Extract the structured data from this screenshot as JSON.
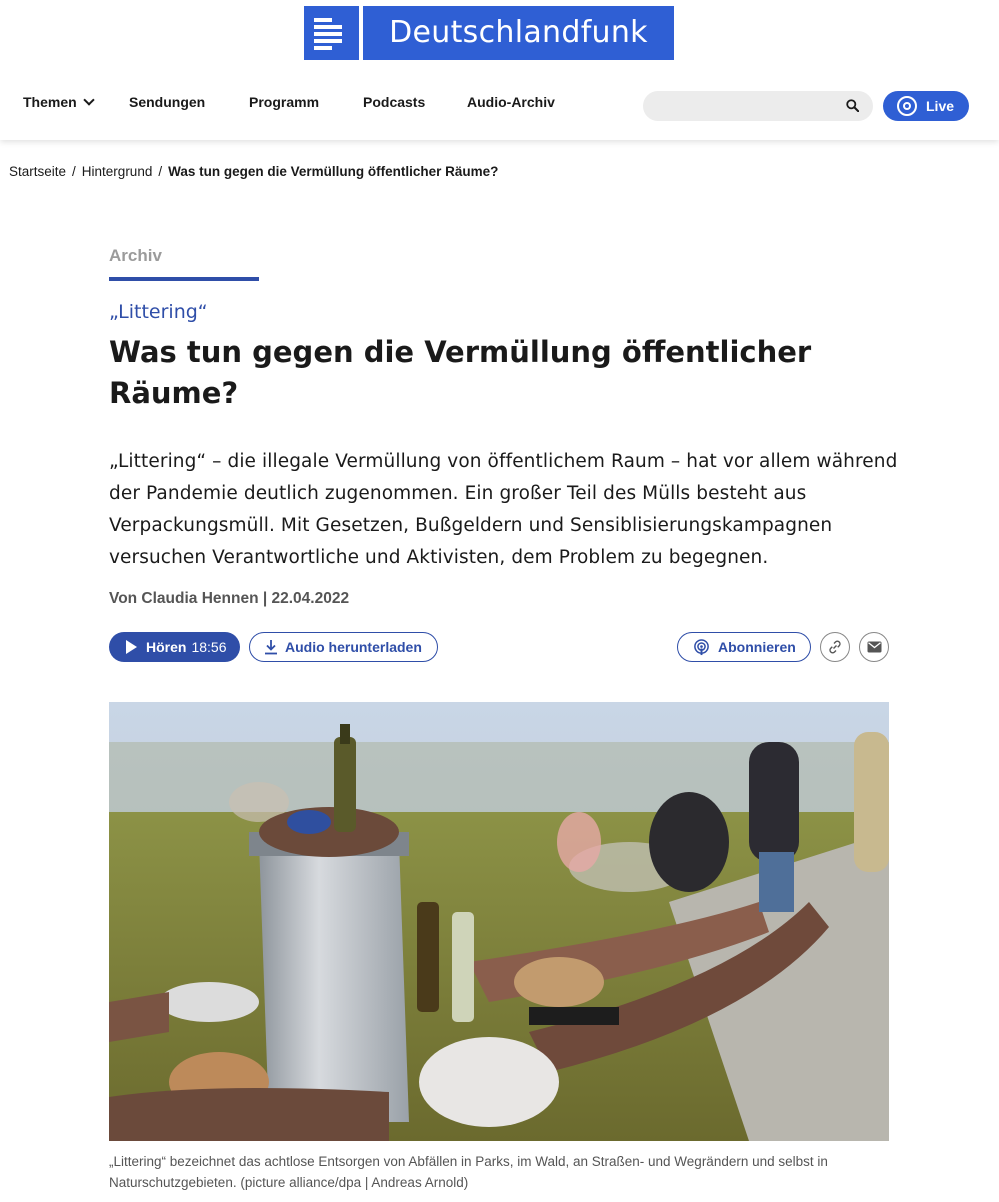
{
  "brand": {
    "name": "Deutschlandfunk",
    "color": "#2f5fd4"
  },
  "nav": {
    "items": [
      "Themen",
      "Sendungen",
      "Programm",
      "Podcasts",
      "Audio-Archiv"
    ],
    "search_placeholder": "",
    "live_label": "Live"
  },
  "breadcrumb": [
    "Startseite",
    "Hintergrund",
    "Was tun gegen die Vermüllung öffentlicher Räume?"
  ],
  "article": {
    "section_label": "Archiv",
    "kicker": "„Littering“",
    "title": "Was tun gegen die Vermüllung öffentlicher Räume?",
    "teaser": "„Littering“ – die illegale Vermüllung von öffentlichem Raum – hat vor allem während der Pandemie deutlich zugenommen. Ein großer Teil des Mülls besteht aus Verpackungsmüll. Mit Gesetzen, Bußgeldern und Sensiblisierungskampagnen versuchen Verantwortliche und Aktivisten, dem Problem zu begegnen.",
    "byline": "Von Claudia Hennen | 22.04.2022",
    "listen_label": "Hören",
    "duration": "18:56",
    "download_label": "Audio herunterladen",
    "subscribe_label": "Abonnieren",
    "image_caption": "„Littering“ bezeichnet das achtlose Entsorgen von Abfällen in Parks, im Wald, an Straßen- und Wegrändern und selbst in Naturschutzgebieten. (picture alliance/dpa | Andreas Arnold)"
  },
  "icons": {
    "logo": "dlf-logo-icon",
    "themen_dropdown": "chevron-down-icon",
    "search": "search-icon",
    "live": "live-radio-icon",
    "play": "play-icon",
    "download": "download-icon",
    "podcast": "podcast-icon",
    "link": "link-icon",
    "mail": "mail-icon"
  }
}
